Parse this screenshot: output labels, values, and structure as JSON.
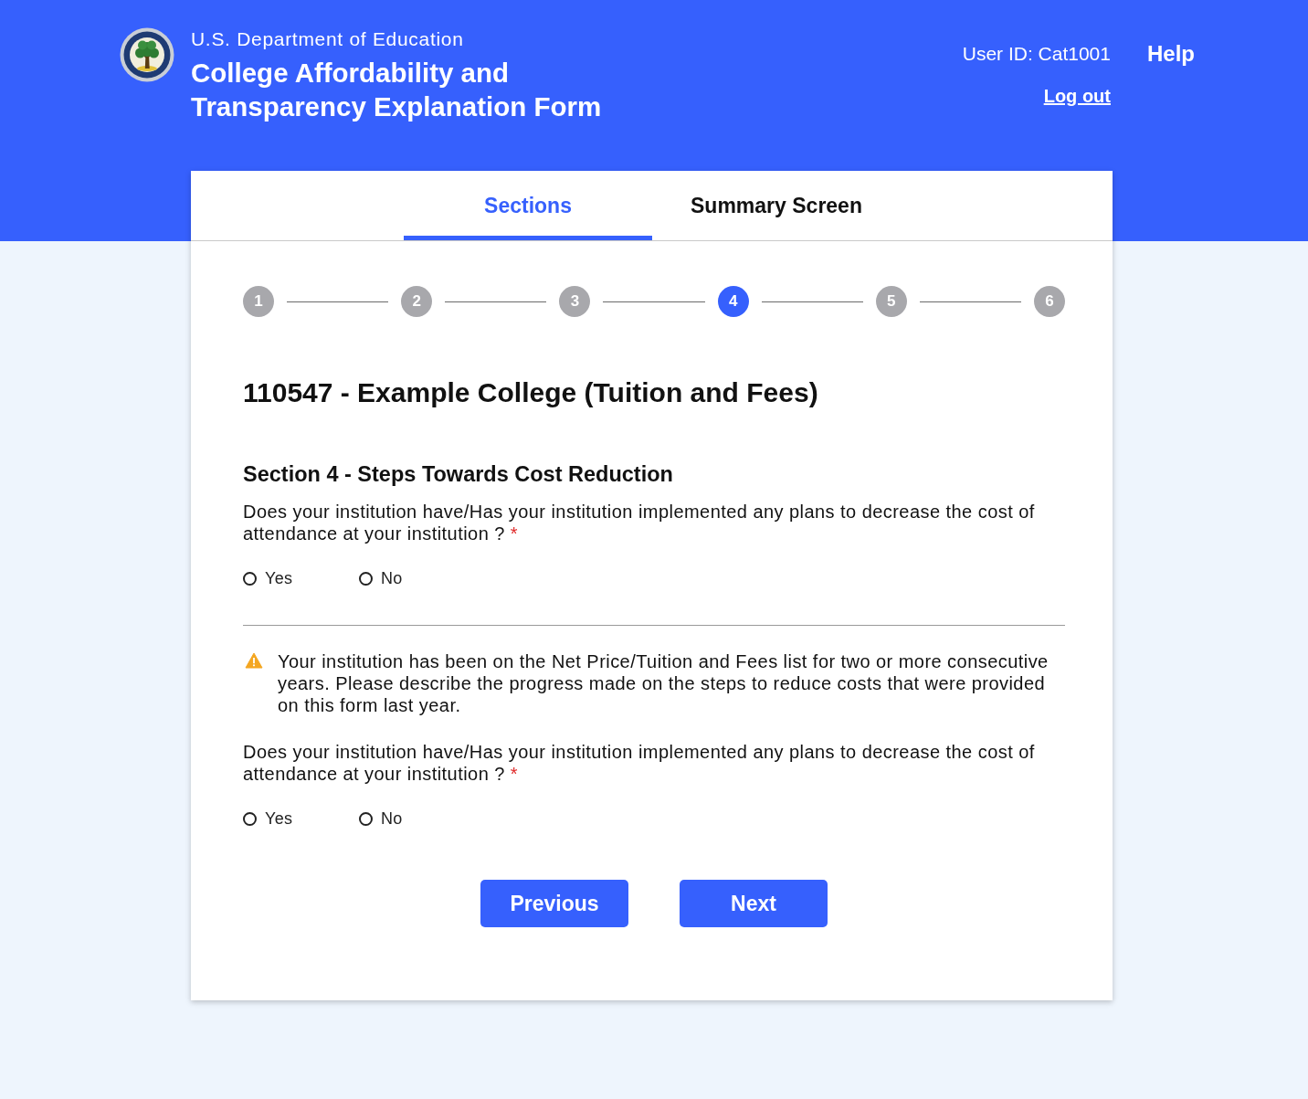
{
  "header": {
    "agency": "U.S. Department of Education",
    "title": "College Affordability and Transparency Explanation Form",
    "user_id": "User ID: Cat1001",
    "help": "Help",
    "logout": "Log out"
  },
  "tabs": [
    {
      "label": "Sections",
      "selected": true
    },
    {
      "label": "Summary Screen",
      "selected": false
    }
  ],
  "steps": [
    {
      "label": "1",
      "selected": false
    },
    {
      "label": "2",
      "selected": false
    },
    {
      "label": "3",
      "selected": false
    },
    {
      "label": "4",
      "selected": true
    },
    {
      "label": "5",
      "selected": false
    },
    {
      "label": "6",
      "selected": false
    }
  ],
  "form": {
    "title": "110547 - Example College (Tuition and Fees)",
    "section_title": "Section 4 - Steps Towards Cost Reduction",
    "blocks": [
      {
        "kind": "question",
        "text": "Does your institution have/Has your institution implemented any plans to decrease the cost of attendance at your institution ?",
        "required_mark": "*",
        "options": [
          {
            "label": "Yes",
            "selected": false
          },
          {
            "label": "No",
            "selected": false
          }
        ]
      },
      {
        "kind": "notice",
        "text": "Your institution has been on the Net Price/Tuition and Fees list for two or more consecutive years. Please describe the progress made on the steps to reduce costs that were provided on this form last year."
      },
      {
        "kind": "question",
        "text": "Does your institution have/Has your institution implemented any plans to decrease the cost of attendance at your institution ?",
        "required_mark": "*",
        "options": [
          {
            "label": "Yes",
            "selected": false
          },
          {
            "label": "No",
            "selected": false
          }
        ]
      }
    ]
  },
  "buttons": [
    "Previous",
    "Next"
  ]
}
